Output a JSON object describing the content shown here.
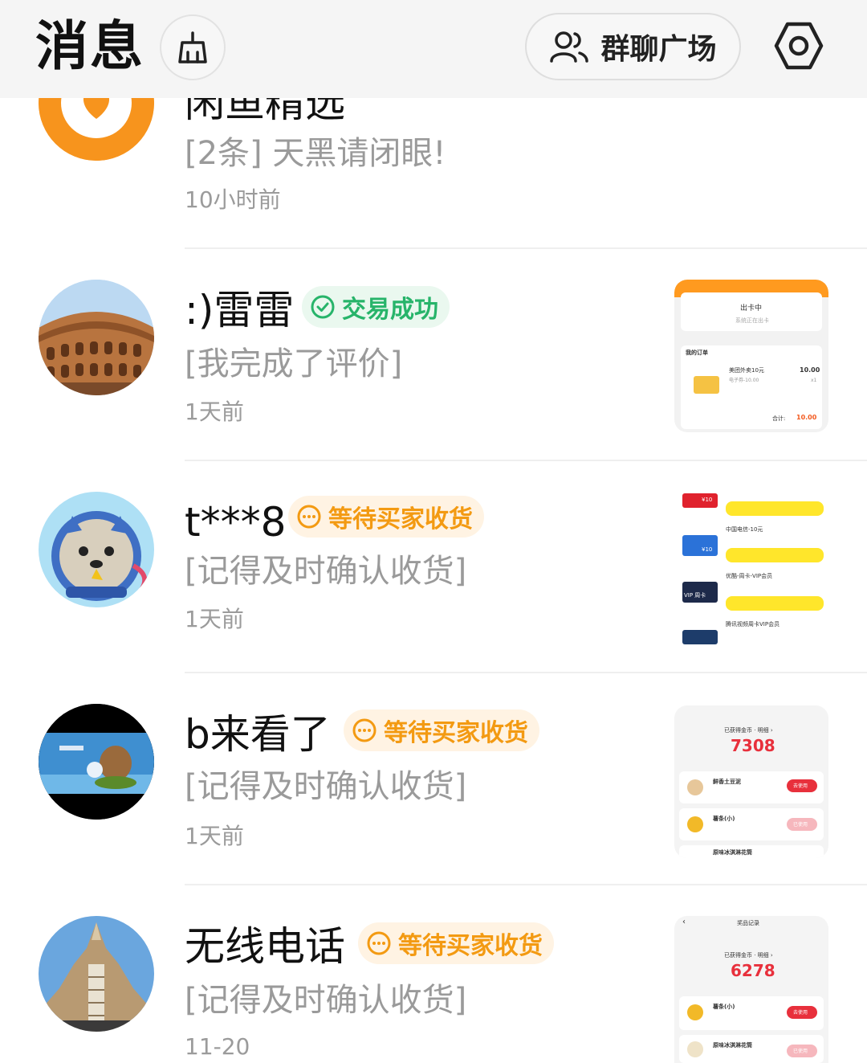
{
  "header": {
    "title": "消息",
    "group_button_label": "群聊广场"
  },
  "conversations": [
    {
      "name": "闲鱼精选",
      "preview": "[2条] 天黑请闭眼!",
      "time": "10小时前",
      "avatar_icon": "heart-icon"
    },
    {
      "name": ":)雷雷",
      "status": "交易成功",
      "preview": "[我完成了评价]",
      "time": "1天前",
      "thumbnail": {
        "title": "出卡中",
        "subtitle": "系统正在出卡",
        "section": "我的订单",
        "product": "美团外卖10元",
        "product_sub": "电子券-10.00",
        "price": "10.00",
        "qty": "x1",
        "total_label": "合计:",
        "total": "10.00"
      }
    },
    {
      "name": "t***8",
      "status": "等待买家收货",
      "preview": "[记得及时确认收货]",
      "time": "1天前",
      "thumbnail": {
        "rows": [
          "中国电信-10元",
          "优酷-周卡-VIP会员",
          "腾讯视频周卡VIP会员"
        ],
        "card_labels": [
          "¥10",
          "¥10",
          "VIP 周卡"
        ]
      }
    },
    {
      "name": "b来看了",
      "status": "等待买家收货",
      "preview": "[记得及时确认收货]",
      "time": "1天前",
      "thumbnail": {
        "header": "已获得金币 · 明细 ›",
        "coins": "7308",
        "items": [
          "鲜香土豆泥",
          "薯条(小)",
          "原味冰淇淋花筒"
        ],
        "btn_primary": "去使用",
        "btn_used": "已使用"
      }
    },
    {
      "name": "无线电话",
      "status": "等待买家收货",
      "preview": "[记得及时确认收货]",
      "time": "11-20",
      "thumbnail": {
        "page_title": "奖品记录",
        "header": "已获得金币 · 明细 ›",
        "coins": "6278",
        "items": [
          "薯条(小)",
          "原味冰淇淋花筒"
        ],
        "btn_primary": "去使用",
        "btn_used": "已使用"
      }
    }
  ],
  "colors": {
    "success_green": "#27b46a",
    "pending_orange": "#f39a12",
    "header_bg": "#f5f5f5"
  }
}
